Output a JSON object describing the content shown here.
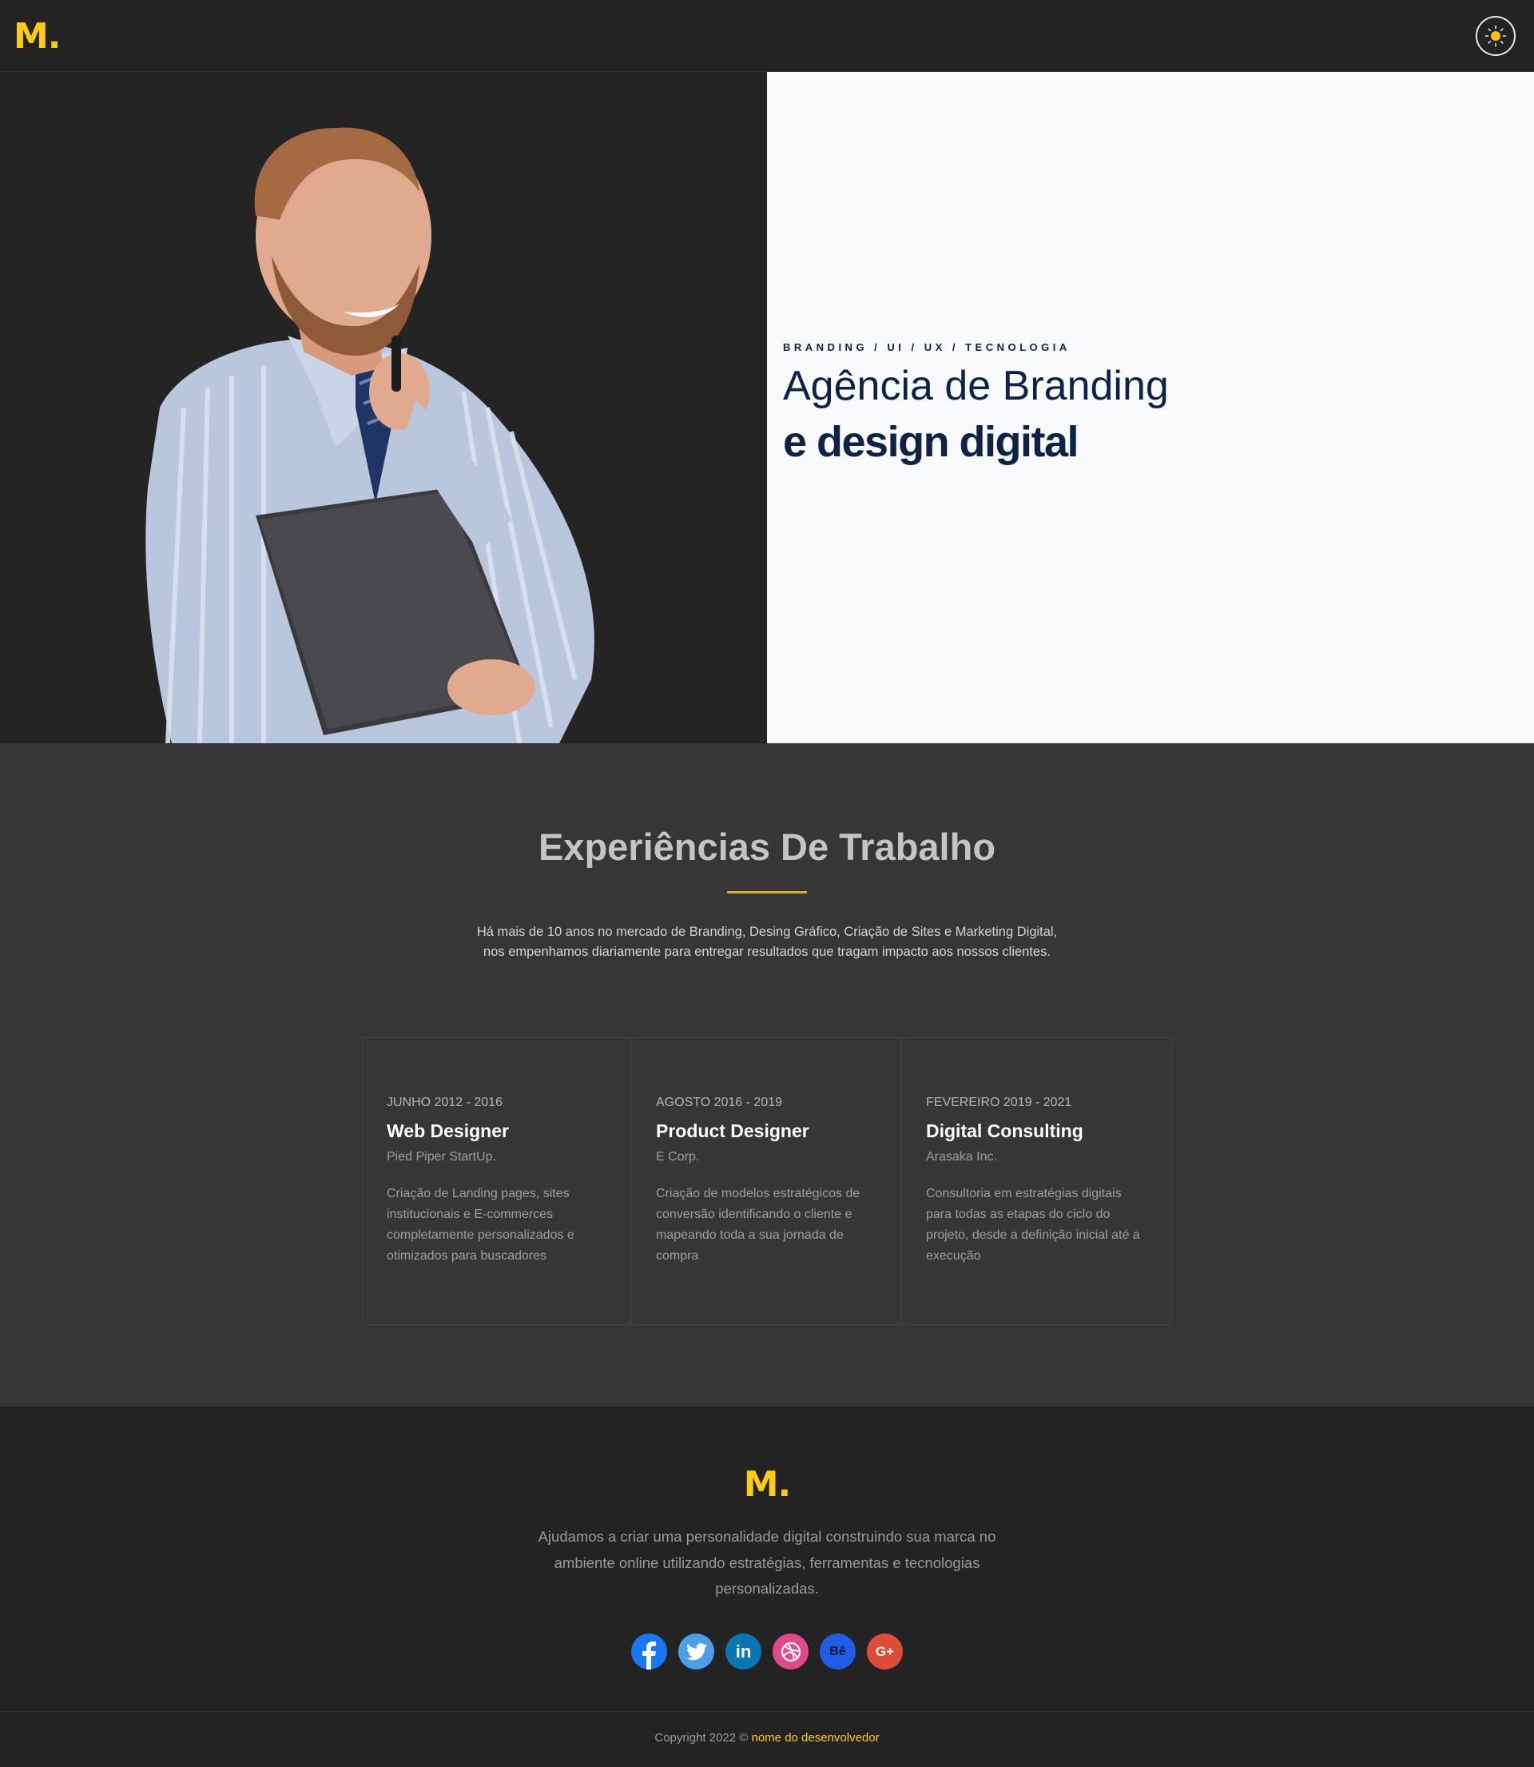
{
  "header": {
    "logo": "M.",
    "theme_toggle_icon": "sun-icon"
  },
  "hero": {
    "tagline": "BRANDING / UI / UX / TECNOLOGIA",
    "title": "Agência de Branding",
    "subtitle": "e design digital",
    "image": "man-holding-folder-photo"
  },
  "experience": {
    "title": "Experiências De Trabalho",
    "description": "Há mais de 10 anos no mercado de Branding, Desing Gráfico, Criação de Sites e Marketing Digital, nos empenhamos diariamente para entregar resultados que tragam impacto aos nossos clientes.",
    "accent_color": "#e3a824",
    "cards": [
      {
        "date": "JUNHO 2012 - 2016",
        "role": "Web Designer",
        "company": "Pied Piper StartUp.",
        "description": "Criação de Landing pages, sites institucionais e E-commerces completamente personalizados e otimizados para buscadores"
      },
      {
        "date": "AGOSTO 2016 - 2019",
        "role": "Product Designer",
        "company": "E Corp.",
        "description": "Criação de modelos estratégicos de conversão identificando o cliente e mapeando toda a sua jornada de compra"
      },
      {
        "date": "FEVEREIRO 2019 - 2021",
        "role": "Digital Consulting",
        "company": "Arasaka Inc.",
        "description": "Consultoria em estratégias digitais para todas as etapas do ciclo do projeto, desde a definição inicial até a execução"
      }
    ]
  },
  "footer": {
    "logo": "M.",
    "text": "Ajudamos a criar uma personalidade digital construindo sua marca no ambiente online utilizando estratégias, ferramentas e tecnologias personalizadas.",
    "socials": [
      {
        "icon": "facebook-icon",
        "color": "#1877f2",
        "glyph": "f"
      },
      {
        "icon": "twitter-icon",
        "color": "#4a9fe8",
        "glyph": "t"
      },
      {
        "icon": "linkedin-icon",
        "color": "#0a77b5",
        "glyph": "in"
      },
      {
        "icon": "dribbble-icon",
        "color": "#e24a87",
        "glyph": "◎"
      },
      {
        "icon": "behance-icon",
        "color": "#1f5de6",
        "glyph": "Bē"
      },
      {
        "icon": "google-plus-icon",
        "color": "#dd4b39",
        "glyph": "G+"
      }
    ],
    "copyright_prefix": "Copyright 2022 ©",
    "copyright_link": "nome do desenvolvedor"
  },
  "colors": {
    "brand_yellow": "#ffcc12",
    "navy": "#0e2247",
    "dark_bg": "#232323",
    "section_bg": "#363636"
  }
}
